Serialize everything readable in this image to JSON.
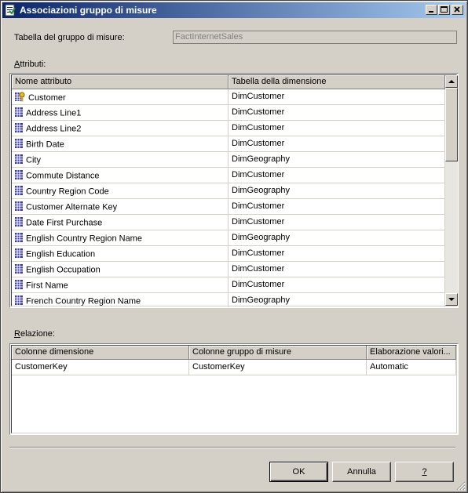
{
  "window": {
    "title": "Associazioni gruppo di misure",
    "icon": "dialog-app-icon"
  },
  "measure_group": {
    "label": "Tabella del gruppo di misure:",
    "value": "FactInternetSales"
  },
  "attributes": {
    "label_prefix": "",
    "label_underlined": "A",
    "label_rest": "ttributi:",
    "columns": [
      "Nome attributo",
      "Tabella della dimensione"
    ],
    "rows": [
      {
        "name": "Customer",
        "table": "DimCustomer",
        "icon": "key-attribute-icon"
      },
      {
        "name": "Address Line1",
        "table": "DimCustomer",
        "icon": "attribute-icon"
      },
      {
        "name": "Address Line2",
        "table": "DimCustomer",
        "icon": "attribute-icon"
      },
      {
        "name": "Birth Date",
        "table": "DimCustomer",
        "icon": "attribute-icon"
      },
      {
        "name": "City",
        "table": "DimGeography",
        "icon": "attribute-icon"
      },
      {
        "name": "Commute Distance",
        "table": "DimCustomer",
        "icon": "attribute-icon"
      },
      {
        "name": "Country Region Code",
        "table": "DimGeography",
        "icon": "attribute-icon"
      },
      {
        "name": "Customer Alternate Key",
        "table": "DimCustomer",
        "icon": "attribute-icon"
      },
      {
        "name": "Date First Purchase",
        "table": "DimCustomer",
        "icon": "attribute-icon"
      },
      {
        "name": "English Country Region Name",
        "table": "DimGeography",
        "icon": "attribute-icon"
      },
      {
        "name": "English Education",
        "table": "DimCustomer",
        "icon": "attribute-icon"
      },
      {
        "name": "English Occupation",
        "table": "DimCustomer",
        "icon": "attribute-icon"
      },
      {
        "name": "First Name",
        "table": "DimCustomer",
        "icon": "attribute-icon"
      },
      {
        "name": "French Country Region Name",
        "table": "DimGeography",
        "icon": "attribute-icon"
      }
    ]
  },
  "relation": {
    "label_underlined": "R",
    "label_rest": "elazione:",
    "columns": [
      "Colonne dimensione",
      "Colonne gruppo di misure",
      "Elaborazione valori..."
    ],
    "rows": [
      {
        "dim": "CustomerKey",
        "mg": "CustomerKey",
        "proc": "Automatic"
      }
    ]
  },
  "buttons": {
    "ok": "OK",
    "cancel": "Annulla",
    "help_underlined": "?"
  },
  "colors": {
    "title_start": "#0a246a",
    "title_end": "#a6caf0",
    "face": "#d4d0c8"
  }
}
